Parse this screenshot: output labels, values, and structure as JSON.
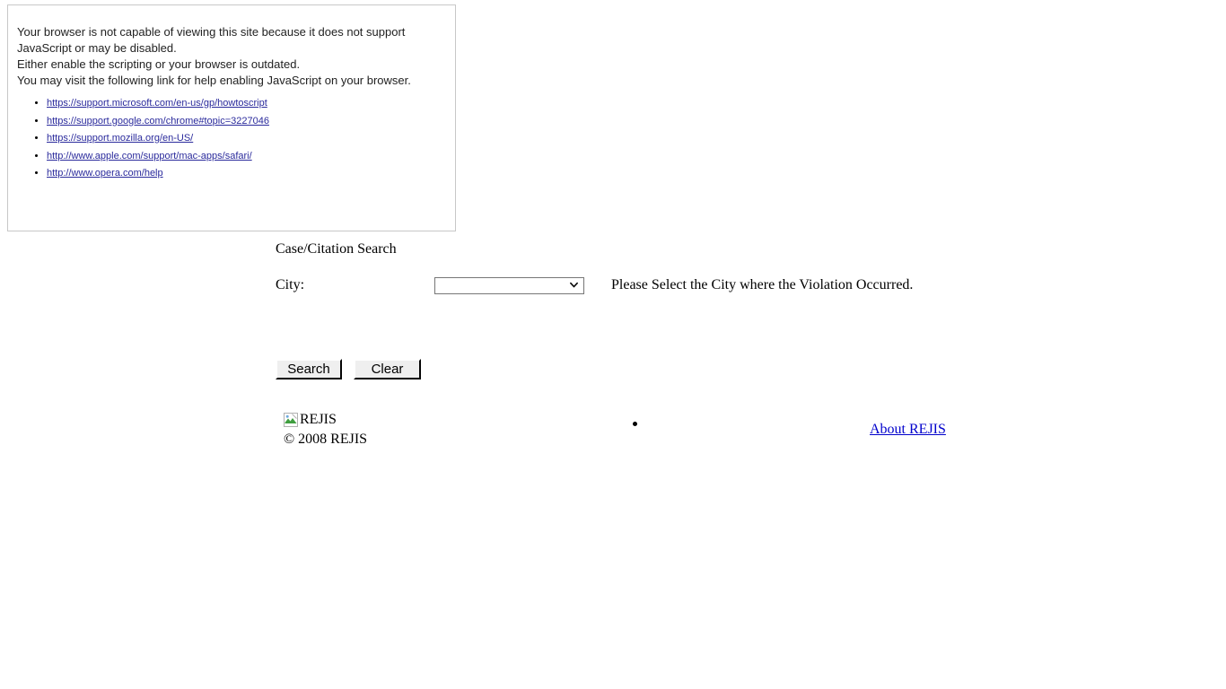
{
  "noscript": {
    "lines": [
      "Your browser is not capable of viewing this site because it does not support",
      "JavaScript or may be disabled.",
      "Either enable the scripting or your browser is outdated.",
      "You may visit the following link for help enabling JavaScript on your browser."
    ],
    "links": [
      "https://support.microsoft.com/en-us/gp/howtoscript",
      "https://support.google.com/chrome#topic=3227046",
      "https://support.mozilla.org/en-US/",
      "http://www.apple.com/support/mac-apps/safari/",
      "http://www.opera.com/help"
    ],
    "link_color": "#2a2a9c",
    "border_color": "#c8c8c8"
  },
  "form": {
    "heading": "Case/Citation Search",
    "city_label": "City:",
    "city_selected_value": "",
    "city_options": [
      ""
    ],
    "city_hint": "Please Select the City where the Violation Occurred.",
    "search_button": "Search",
    "clear_button": "Clear"
  },
  "footer": {
    "logo_alt": "REJIS",
    "logo_icon": "broken-image-icon",
    "copyright": "© 2008 REJIS",
    "about_link": "About REJIS",
    "about_link_color": "#0000cc"
  }
}
